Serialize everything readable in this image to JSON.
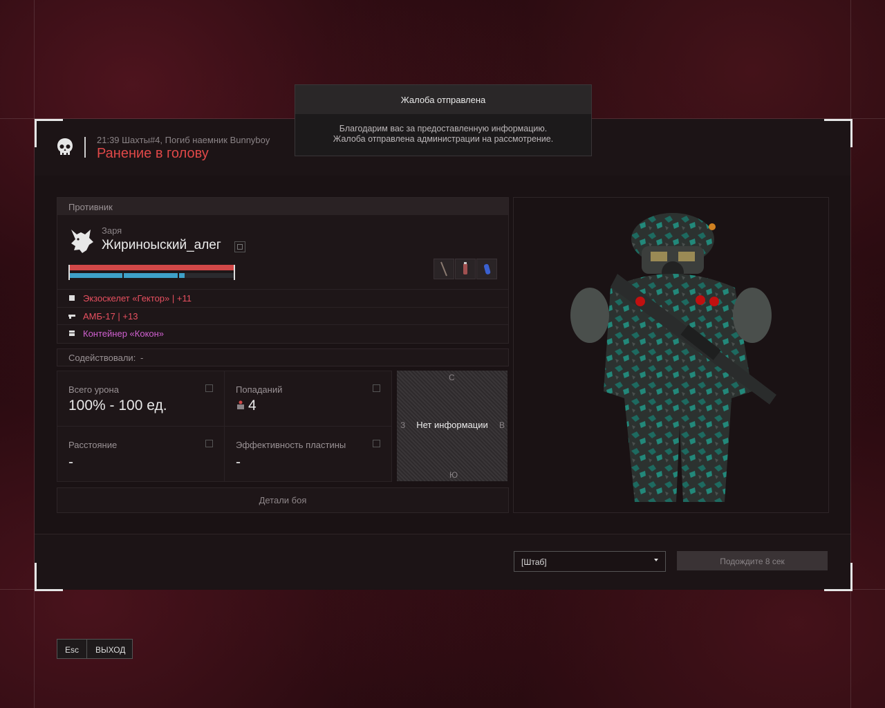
{
  "toast": {
    "title": "Жалоба отправлена",
    "line1": "Благодарим вас за предоставленную информацию.",
    "line2": "Жалоба отправлена администрации на рассмотрение."
  },
  "header": {
    "meta": "21:39 Шахты#4, Погиб наемник Bunnyboy",
    "title": "Ранение в голову",
    "icon": "skull-icon"
  },
  "enemy": {
    "section_label": "Противник",
    "clan": "Заря",
    "nickname": "Жириноыский_алег",
    "health_fraction": 1.0,
    "armor_fraction": 0.7,
    "equipment": [
      {
        "icon": "armor-icon",
        "text": "Экзоскелет «Гектор» | +11",
        "color": "#e85060"
      },
      {
        "icon": "rifle-icon",
        "text": "АМБ-17 | +13",
        "color": "#e85060"
      },
      {
        "icon": "container-icon",
        "text": "Контейнер «Кокон»",
        "color": "#d060d0"
      }
    ]
  },
  "assist": {
    "label": "Содействовали:",
    "value": "-"
  },
  "stats": {
    "total_damage_label": "Всего урона",
    "total_damage_value": "100% - 100 ед.",
    "hits_label": "Попаданий",
    "hits_value": "4",
    "distance_label": "Расстояние",
    "distance_value": "-",
    "plate_label": "Эффективность пластины",
    "plate_value": "-"
  },
  "compass": {
    "n": "С",
    "s": "Ю",
    "w": "З",
    "e": "В",
    "no_info": "Нет информации"
  },
  "details_button": "Детали боя",
  "footer": {
    "select_value": "[Штаб]",
    "wait_label": "Подождите 8 сек"
  },
  "exit": {
    "key": "Esc",
    "label": "ВЫХОД"
  }
}
